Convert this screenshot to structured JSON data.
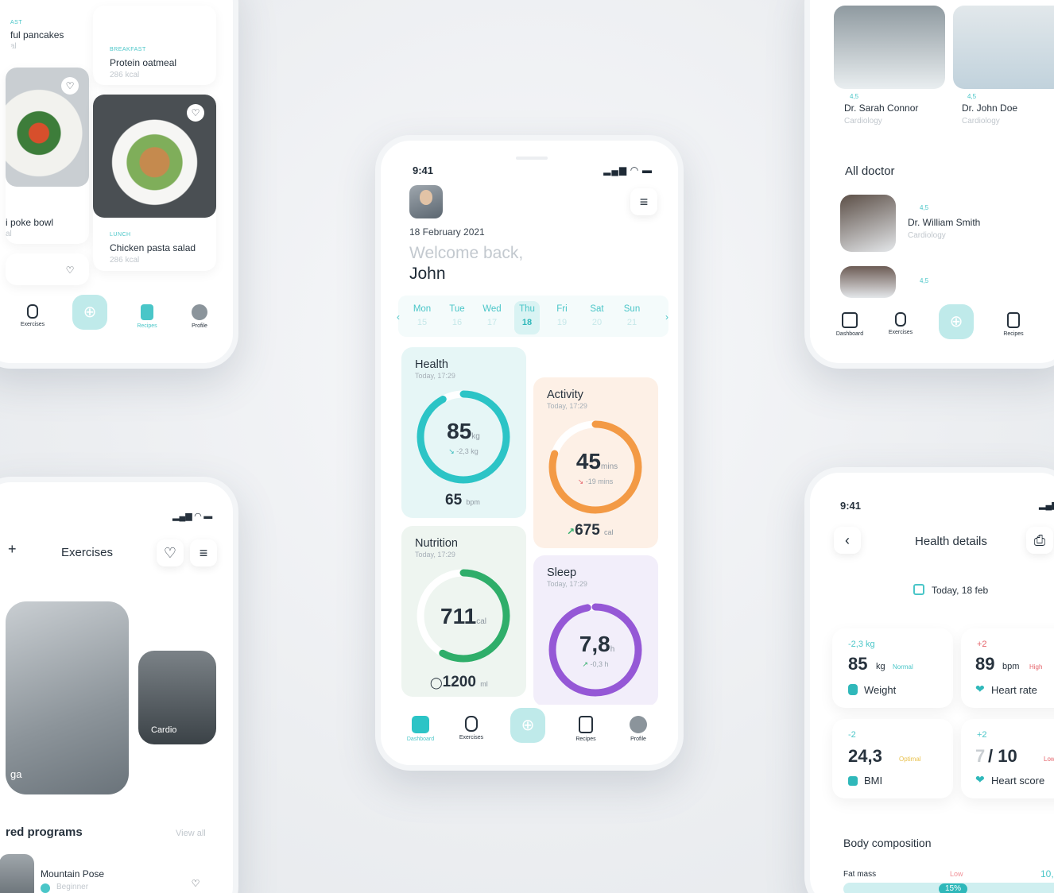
{
  "center": {
    "time": "9:41",
    "date": "18 February 2021",
    "welcome": "Welcome back,",
    "user_name": "John",
    "days": [
      {
        "label": "Mon",
        "num": "15"
      },
      {
        "label": "Tue",
        "num": "16"
      },
      {
        "label": "Wed",
        "num": "17"
      },
      {
        "label": "Thu",
        "num": "18",
        "selected": true
      },
      {
        "label": "Fri",
        "num": "19"
      },
      {
        "label": "Sat",
        "num": "20"
      },
      {
        "label": "Sun",
        "num": "21"
      }
    ],
    "health": {
      "title": "Health",
      "time": "Today, 17:29",
      "value": "85",
      "unit": "kg",
      "delta": "-2,3 kg",
      "sub_value": "65",
      "sub_unit": "bpm",
      "color": "#2cc4c6",
      "progress": 0.92
    },
    "activity": {
      "title": "Activity",
      "time": "Today, 17:29",
      "value": "45",
      "unit": "mins",
      "delta": "-19 mins",
      "sub_value": "675",
      "sub_unit": "cal",
      "color": "#f39a45",
      "progress": 0.8
    },
    "nutrition": {
      "title": "Nutrition",
      "time": "Today, 17:29",
      "value": "711",
      "unit": "cal",
      "sub_value": "1200",
      "sub_unit": "ml",
      "color": "#2fae6a",
      "progress": 0.58
    },
    "sleep": {
      "title": "Sleep",
      "time": "Today, 17:29",
      "value": "7,8",
      "unit": "h",
      "delta": "-0,3 h",
      "color": "#9558d6",
      "progress": 0.97
    },
    "nav": {
      "dashboard": "Dashboard",
      "exercises": "Exercises",
      "recipes": "Recipes",
      "profile": "Profile"
    }
  },
  "top_left": {
    "items": [
      {
        "tag": "AST",
        "name": "ful pancakes",
        "kcal": "al"
      },
      {
        "tag": "BREAKFAST",
        "name": "Protein oatmeal",
        "kcal": "286 kcal"
      },
      {
        "name": "i poke bowl",
        "kcal": "al"
      },
      {
        "tag": "LUNCH",
        "name": "Chicken pasta salad",
        "kcal": "286 kcal"
      }
    ],
    "nav": {
      "exercises": "Exercises",
      "recipes": "Recipes",
      "profile": "Profile"
    }
  },
  "top_right": {
    "doctors": [
      {
        "rating": "4,5",
        "name": "Dr. Sarah Connor",
        "spec": "Cardiology"
      },
      {
        "rating": "4,5",
        "name": "Dr. John Doe",
        "spec": "Cardiology"
      }
    ],
    "all_title": "All doctor",
    "list": [
      {
        "rating": "4,5",
        "name": "Dr. William Smith",
        "spec": "Cardiology"
      },
      {
        "rating": "4,5"
      }
    ],
    "nav": {
      "dashboard": "Dashboard",
      "exercises": "Exercises",
      "recipes": "Recipes"
    }
  },
  "bottom_left": {
    "title": "Exercises",
    "card_yoga": "ga",
    "card_cardio": "Cardio",
    "programs_title": "red programs",
    "view_all": "View all",
    "program": {
      "name": "Mountain Pose",
      "level": "Beginner"
    }
  },
  "bottom_right": {
    "time": "9:41",
    "title": "Health details",
    "date": "Today, 18 feb",
    "metrics": [
      {
        "delta": "-2,3 kg",
        "value": "85",
        "unit": "kg",
        "status": "Normal",
        "label": "Weight"
      },
      {
        "delta": "+2",
        "value": "89",
        "unit": "bpm",
        "status": "High",
        "label": "Heart rate"
      },
      {
        "delta": "-2",
        "value": "24,3",
        "unit": "",
        "status": "Optimal",
        "label": "BMI"
      },
      {
        "delta": "+2",
        "value": "7",
        "unit": "/ 10",
        "status": "Low",
        "label": "Heart score"
      }
    ],
    "body_title": "Body composition",
    "fat_label": "Fat mass",
    "fat_status": "Low",
    "fat_value": "10,",
    "fat_percent": "15%"
  }
}
